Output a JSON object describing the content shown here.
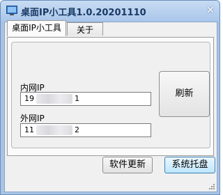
{
  "window": {
    "title": "桌面IP小工具1.0.20201110",
    "close_glyph": "✕"
  },
  "tabs": [
    {
      "label": "桌面IP小工具"
    },
    {
      "label": "关于"
    }
  ],
  "panel": {
    "internal_label": "内网IP",
    "internal_ip_prefix": "19",
    "internal_ip_suffix": "1",
    "external_label": "外网IP",
    "external_ip_prefix": "11",
    "external_ip_suffix": "2",
    "refresh_label": "刷新"
  },
  "buttons": {
    "update": "软件更新",
    "tray": "系统托盘"
  },
  "colors": {
    "title_text": "#1a3a66",
    "frame": "#a9c3e4",
    "primary_button": "#bee6fd"
  }
}
